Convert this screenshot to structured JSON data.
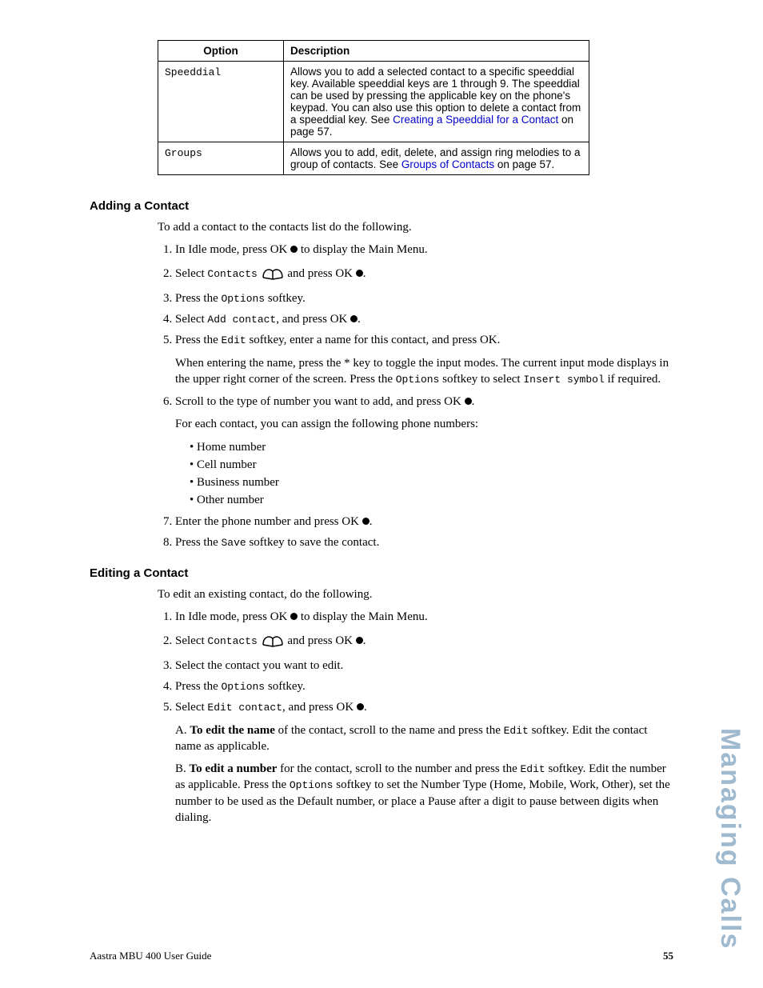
{
  "table": {
    "head": {
      "option": "Option",
      "desc": "Description"
    },
    "rows": [
      {
        "opt": "Speeddial",
        "desc_pre": "Allows you to add a selected contact to a specific speeddial key. Available speeddial keys are 1 through 9. The speeddial can be used by pressing the applicable key on the phone's keypad. You can also use this option to delete a contact from a speeddial key. See ",
        "desc_link": "Creating a Speeddial for a Contact",
        "desc_post": " on page 57."
      },
      {
        "opt": "Groups",
        "desc_pre": "Allows you to add, edit, delete, and assign ring melodies to a group of contacts. See ",
        "desc_link": "Groups of Contacts",
        "desc_post": " on page 57."
      }
    ]
  },
  "adding": {
    "title": "Adding a Contact",
    "intro": "To add a contact to the contacts list do the following.",
    "s1_a": "In Idle mode, press OK ",
    "s1_b": " to display the Main Menu.",
    "s2_a": "Select ",
    "s2_contacts": "Contacts",
    "s2_b": " and press OK ",
    "s2_c": ".",
    "s3_a": "Press the ",
    "s3_opt": "Options",
    "s3_b": " softkey.",
    "s4_a": "Select ",
    "s4_add": "Add contact",
    "s4_b": ", and press OK ",
    "s4_c": ".",
    "s5_a": "Press the ",
    "s5_edit": "Edit",
    "s5_b": " softkey, enter a name for this contact, and press OK.",
    "s5_note_a": "When entering the name, press the * key to toggle the input modes. The current input mode displays in the upper right corner of the screen. Press the ",
    "s5_note_opt": "Options",
    "s5_note_b": " softkey to select ",
    "s5_note_ins": "Insert symbol",
    "s5_note_c": " if required.",
    "s6_a": "Scroll to the type of number you want to add, and press OK ",
    "s6_b": ".",
    "s6_note": "For each contact, you can assign the following phone numbers:",
    "bullets": [
      "Home number",
      "Cell number",
      "Business number",
      "Other number"
    ],
    "s7_a": "Enter the phone number and press OK ",
    "s7_b": ".",
    "s8_a": "Press the ",
    "s8_save": "Save",
    "s8_b": " softkey to save the contact."
  },
  "editing": {
    "title": "Editing a Contact",
    "intro": "To edit an existing contact, do the following.",
    "s1_a": "In Idle mode, press OK ",
    "s1_b": " to display the Main Menu.",
    "s2_a": "Select ",
    "s2_contacts": "Contacts",
    "s2_b": " and press OK ",
    "s2_c": ".",
    "s3": "Select the contact you want to edit.",
    "s4_a": "Press the ",
    "s4_opt": "Options",
    "s4_b": " softkey.",
    "s5_a": "Select ",
    "s5_edit": "Edit contact",
    "s5_b": ", and press OK ",
    "s5_c": ".",
    "A_pre": "A. ",
    "A_bold": "To edit the name",
    "A_mid": " of the contact, scroll to the name and press the ",
    "A_edit": "Edit",
    "A_post": " softkey. Edit the contact name as applicable.",
    "B_pre": "B. ",
    "B_bold": "To edit a number",
    "B_mid": " for the contact, scroll to the number and press the ",
    "B_edit": "Edit",
    "B_mid2": " softkey. Edit the number as applicable. Press the ",
    "B_opt": "Options",
    "B_post": " softkey to set the Number Type (Home, Mobile, Work, Other), set the number to be used as the Default number, or place a Pause after a digit to pause between digits when dialing."
  },
  "footer": {
    "left": "Aastra MBU 400 User Guide",
    "page": "55"
  },
  "sidetab": "Managing Calls"
}
